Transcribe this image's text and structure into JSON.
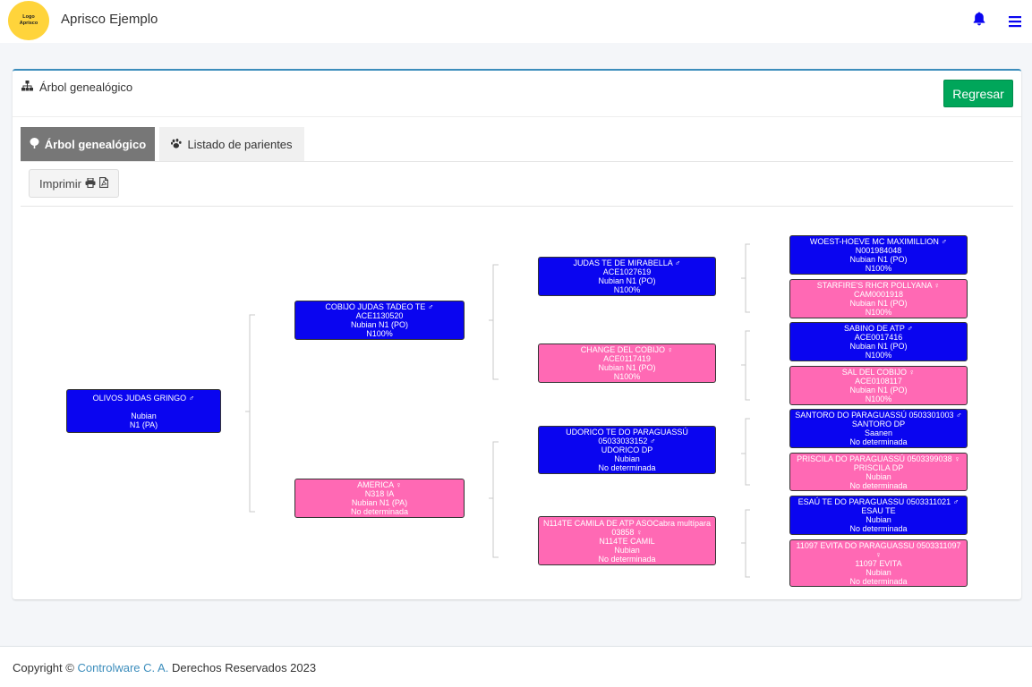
{
  "header": {
    "logo_line1": "Logo",
    "logo_line2": "Aprisco",
    "app_title": "Aprisco Ejemplo"
  },
  "card": {
    "title": "Árbol genealógico",
    "back_button": "Regresar"
  },
  "tabs": [
    {
      "label": "Árbol genealógico",
      "active": true,
      "icon": "tree-icon"
    },
    {
      "label": "Listado de parientes",
      "active": false,
      "icon": "paw-icon"
    }
  ],
  "print_button": "Imprimir",
  "colors": {
    "male": "#0a05f0",
    "female": "#ff69b4",
    "accent": "#3c8dbc",
    "success": "#00a65a"
  },
  "tree": {
    "subject": {
      "sex": "male",
      "lines": [
        "OLIVOS JUDAS GRINGO ♂",
        "",
        "Nubian",
        "N1 (PA)"
      ]
    },
    "sire": {
      "sex": "male",
      "lines": [
        "COBIJO JUDAS TADEO TE ♂",
        "ACE1130520",
        "Nubian N1 (PO)",
        "N100%"
      ]
    },
    "dam": {
      "sex": "female",
      "lines": [
        "AMERICA ♀",
        "N318 IA",
        "Nubian N1 (PA)",
        "No determinada"
      ]
    },
    "sire_sire": {
      "sex": "male",
      "lines": [
        "JUDAS TE DE MIRABELLA ♂",
        "ACE1027619",
        "Nubian N1 (PO)",
        "N100%"
      ]
    },
    "sire_dam": {
      "sex": "female",
      "lines": [
        "CHANGE DEL COBIJO ♀",
        "ACE0117419",
        "Nubian N1 (PO)",
        "N100%"
      ]
    },
    "dam_sire": {
      "sex": "male",
      "lines": [
        "UDORICO TE DO PARAGUASSÚ",
        "05033033152 ♂",
        "UDORICO DP",
        "Nubian",
        "No determinada"
      ]
    },
    "dam_dam": {
      "sex": "female",
      "lines": [
        "N114TE CAMILA DE ATP ASOCabra multípara 03858 ♀",
        "N114TE CAMIL",
        "Nubian",
        "No determinada"
      ]
    },
    "sss": {
      "sex": "male",
      "lines": [
        "WOEST-HOEVE MC MAXIMILLION ♂",
        "N001984048",
        "Nubian N1 (PO)",
        "N100%"
      ]
    },
    "ssd": {
      "sex": "female",
      "lines": [
        "STARFIRE'S RHCR POLLYANA ♀",
        "CAM0001918",
        "Nubian N1 (PO)",
        "N100%"
      ]
    },
    "sds": {
      "sex": "male",
      "lines": [
        "SABINO DE ATP ♂",
        "ACE0017416",
        "Nubian N1 (PO)",
        "N100%"
      ]
    },
    "sdd": {
      "sex": "female",
      "lines": [
        "SAL DEL COBIJO ♀",
        "ACE0108117",
        "Nubian N1 (PO)",
        "N100%"
      ]
    },
    "dss": {
      "sex": "male",
      "lines": [
        "SANTORO DO PARAGUASSÚ 0503301003 ♂",
        "SANTORO DP",
        "Saanen",
        "No determinada"
      ]
    },
    "dsd": {
      "sex": "female",
      "lines": [
        "PRISCILA DO PARAGUASSÚ 0503399038 ♀",
        "PRISCILA DP",
        "Nubian",
        "No determinada"
      ]
    },
    "dds": {
      "sex": "male",
      "lines": [
        "ESAÚ TE DO PARAGUASSU 0503311021 ♂",
        "ESAU TE",
        "Nubian",
        "No determinada"
      ]
    },
    "ddd": {
      "sex": "female",
      "lines": [
        "11097 EVITA DO PARAGUASSU 0503311097 ♀",
        "11097 EVITA",
        "Nubian",
        "No determinada"
      ]
    }
  },
  "footer": {
    "prefix": "Copyright ©",
    "company": "Controlware C. A.",
    "suffix": "Derechos Reservados 2023"
  }
}
